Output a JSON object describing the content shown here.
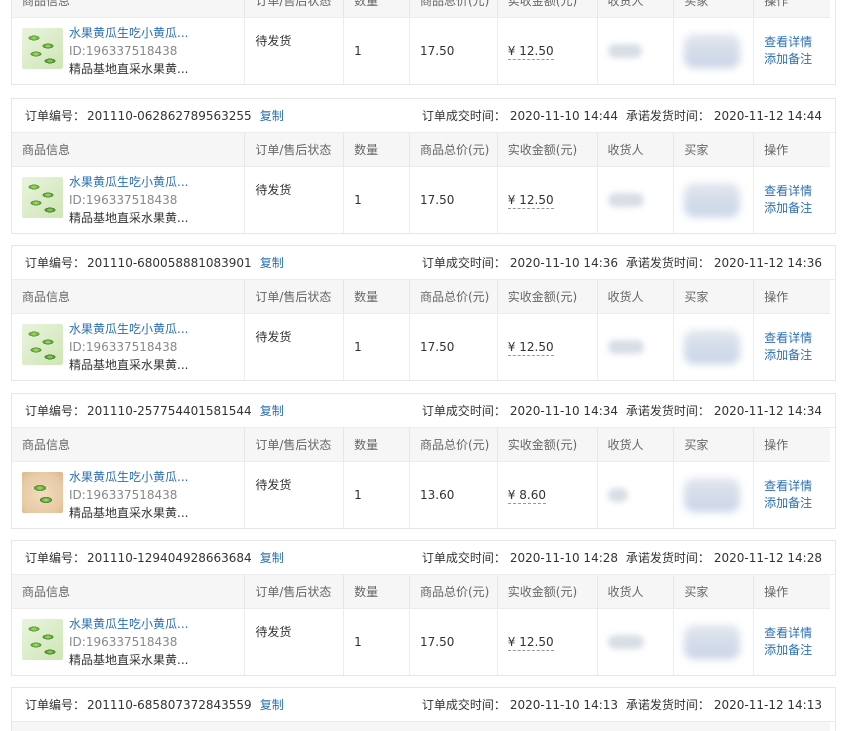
{
  "labels": {
    "order_no_prefix": "订单编号：",
    "copy": "复制",
    "deal_time_prefix": "订单成交时间：",
    "ship_time_prefix": "承诺发货时间："
  },
  "columns": [
    "商品信息",
    "订单/售后状态",
    "数量",
    "商品总价(元)",
    "实收金额(元)",
    "收货人",
    "买家",
    "操作"
  ],
  "actions": {
    "view_detail": "查看详情",
    "add_note": "添加备注"
  },
  "orders": [
    {
      "order_no": "",
      "deal_time": "",
      "ship_time": "",
      "product_name": "水果黄瓜生吃小黄瓜...",
      "product_id": "ID:196337518438",
      "product_desc": "精品基地直采水果黄...",
      "status": "待发货",
      "qty": "1",
      "total": "17.50",
      "paid": "¥ 12.50"
    },
    {
      "order_no": "201110-062862789563255",
      "deal_time": "2020-11-10 14:44",
      "ship_time": "2020-11-12 14:44",
      "product_name": "水果黄瓜生吃小黄瓜...",
      "product_id": "ID:196337518438",
      "product_desc": "精品基地直采水果黄...",
      "status": "待发货",
      "qty": "1",
      "total": "17.50",
      "paid": "¥ 12.50"
    },
    {
      "order_no": "201110-680058881083901",
      "deal_time": "2020-11-10 14:36",
      "ship_time": "2020-11-12 14:36",
      "product_name": "水果黄瓜生吃小黄瓜...",
      "product_id": "ID:196337518438",
      "product_desc": "精品基地直采水果黄...",
      "status": "待发货",
      "qty": "1",
      "total": "17.50",
      "paid": "¥ 12.50"
    },
    {
      "order_no": "201110-257754401581544",
      "deal_time": "2020-11-10 14:34",
      "ship_time": "2020-11-12 14:34",
      "product_name": "水果黄瓜生吃小黄瓜...",
      "product_id": "ID:196337518438",
      "product_desc": "精品基地直采水果黄...",
      "status": "待发货",
      "qty": "1",
      "total": "13.60",
      "paid": "¥ 8.60"
    },
    {
      "order_no": "201110-129404928663684",
      "deal_time": "2020-11-10 14:28",
      "ship_time": "2020-11-12 14:28",
      "product_name": "水果黄瓜生吃小黄瓜...",
      "product_id": "ID:196337518438",
      "product_desc": "精品基地直采水果黄...",
      "status": "待发货",
      "qty": "1",
      "total": "17.50",
      "paid": "¥ 12.50"
    },
    {
      "order_no": "201110-685807372843559",
      "deal_time": "2020-11-10 14:13",
      "ship_time": "2020-11-12 14:13"
    }
  ]
}
